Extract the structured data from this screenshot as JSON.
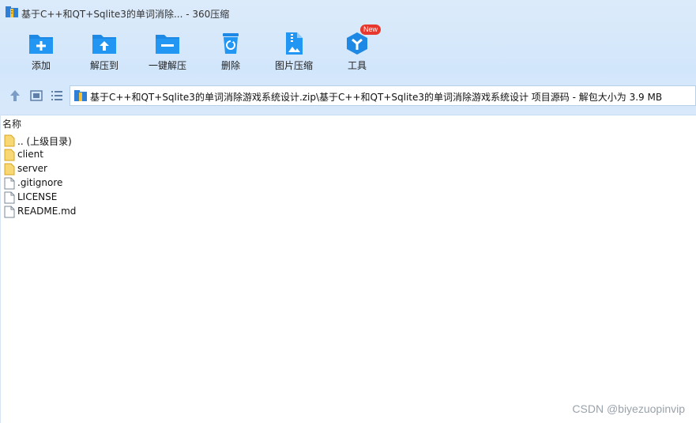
{
  "window": {
    "title": "基于C++和QT+Sqlite3的单词消除... - 360压缩"
  },
  "toolbar": {
    "items": [
      {
        "label": "添加"
      },
      {
        "label": "解压到"
      },
      {
        "label": "一键解压"
      },
      {
        "label": "删除"
      },
      {
        "label": "图片压缩"
      },
      {
        "label": "工具",
        "badge": "New"
      }
    ]
  },
  "address": {
    "path": "基于C++和QT+Sqlite3的单词消除游戏系统设计.zip\\基于C++和QT+Sqlite3的单词消除游戏系统设计 项目源码 - 解包大小为 3.9 MB"
  },
  "list": {
    "column_name": "名称",
    "rows": [
      {
        "name": ".. (上级目录)",
        "type": "folder"
      },
      {
        "name": "client",
        "type": "folder"
      },
      {
        "name": "server",
        "type": "folder"
      },
      {
        "name": ".gitignore",
        "type": "file"
      },
      {
        "name": "LICENSE",
        "type": "file"
      },
      {
        "name": "README.md",
        "type": "file"
      }
    ]
  },
  "watermark": "CSDN @biyezuopinvip",
  "colors": {
    "accent": "#1e88e5",
    "folder": "#f5c542",
    "chrome_bg": "#d2e6fb"
  }
}
